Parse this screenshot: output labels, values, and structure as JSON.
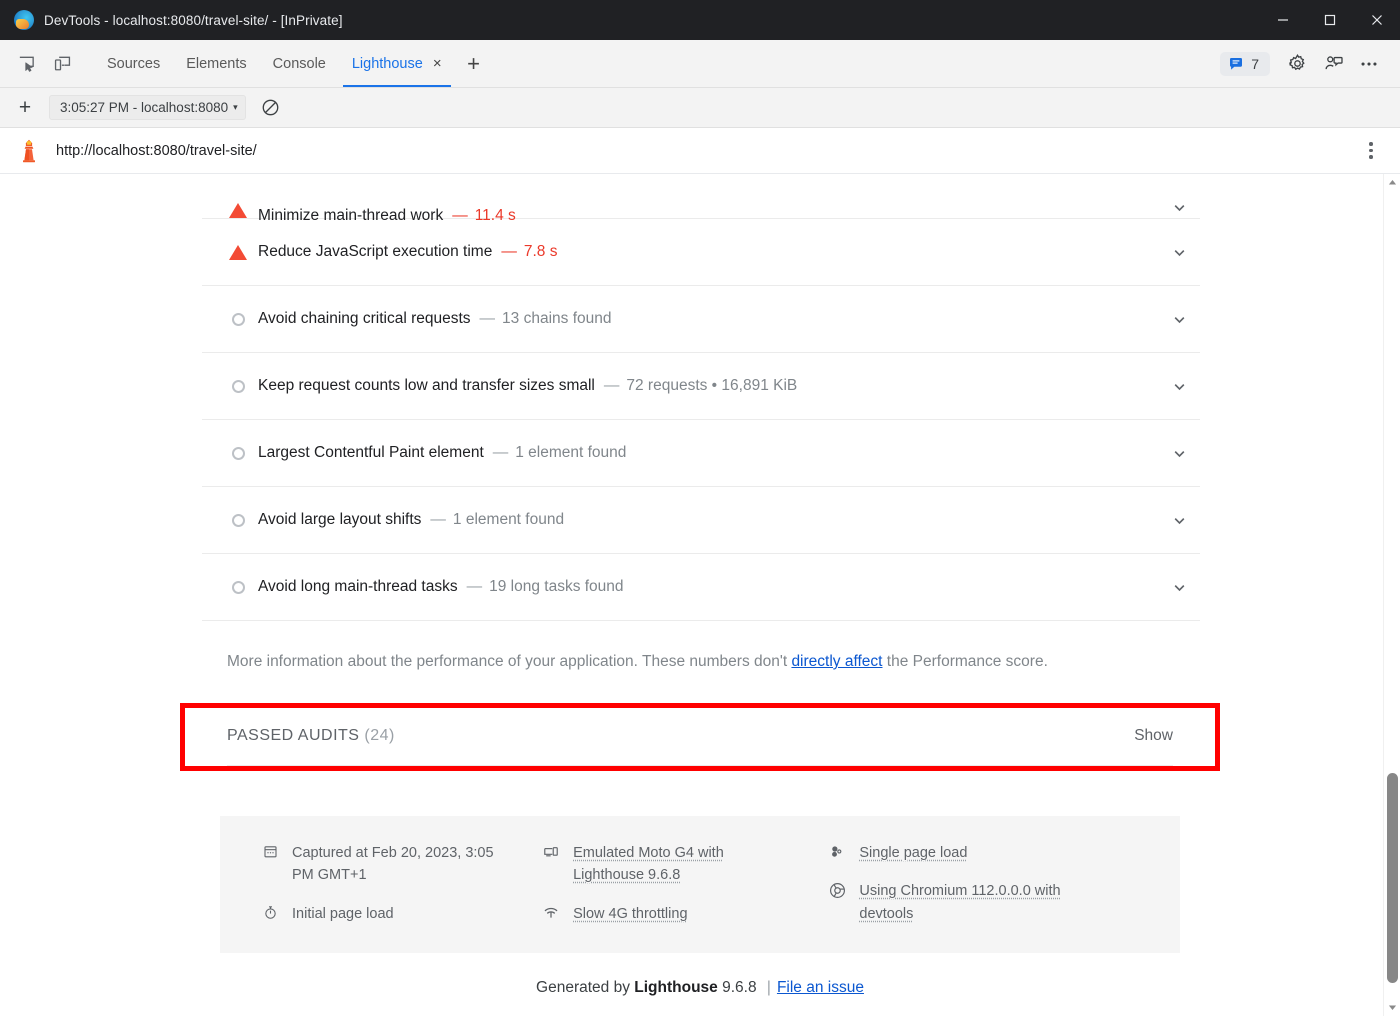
{
  "window": {
    "title": "DevTools - localhost:8080/travel-site/ - [InPrivate]",
    "minimize_label": "Minimize",
    "maximize_label": "Maximize",
    "close_label": "Close"
  },
  "devtools": {
    "inspect_icon": "inspect-element-icon",
    "device_icon": "device-toolbar-icon",
    "tabs": [
      {
        "label": "Sources",
        "active": false
      },
      {
        "label": "Elements",
        "active": false
      },
      {
        "label": "Console",
        "active": false
      },
      {
        "label": "Lighthouse",
        "active": true
      }
    ],
    "tab_close_glyph": "×",
    "more_tabs_glyph": "+",
    "messages_count": "7",
    "settings_icon": "gear-icon",
    "feedback_icon": "feedback-person-icon",
    "more_icon": "more-horizontal-icon"
  },
  "lighthouse_toolbar": {
    "new_report_glyph": "+",
    "report_select_value": "3:05:27 PM - localhost:8080",
    "caret_glyph": "▾",
    "clear_icon": "clear-all-icon"
  },
  "report": {
    "url": "http://localhost:8080/travel-site/",
    "lighthouse_icon": "lighthouse-logo-icon",
    "kebab_icon": "more-vertical-icon"
  },
  "audits": [
    {
      "status": "fail",
      "title": "Minimize main-thread work",
      "dash": "—",
      "value": "11.4 s",
      "chevron": "chevron-down-icon"
    },
    {
      "status": "fail",
      "title": "Reduce JavaScript execution time",
      "dash": "—",
      "value": "7.8 s",
      "chevron": "chevron-down-icon"
    },
    {
      "status": "info",
      "title": "Avoid chaining critical requests",
      "dash": "—",
      "value": "13 chains found",
      "chevron": "chevron-down-icon"
    },
    {
      "status": "info",
      "title": "Keep request counts low and transfer sizes small",
      "dash": "—",
      "value": "72 requests • 16,891 KiB",
      "chevron": "chevron-down-icon"
    },
    {
      "status": "info",
      "title": "Largest Contentful Paint element",
      "dash": "—",
      "value": "1 element found",
      "chevron": "chevron-down-icon"
    },
    {
      "status": "info",
      "title": "Avoid large layout shifts",
      "dash": "—",
      "value": "1 element found",
      "chevron": "chevron-down-icon"
    },
    {
      "status": "info",
      "title": "Avoid long main-thread tasks",
      "dash": "—",
      "value": "19 long tasks found",
      "chevron": "chevron-down-icon"
    }
  ],
  "more_info": {
    "before_link": "More information about the performance of your application. These numbers don't ",
    "link_text": "directly affect",
    "after_link": " the Performance score."
  },
  "passed_audits": {
    "label": "PASSED AUDITS",
    "count": "(24)",
    "toggle_label": "Show",
    "highlight_color": "#ff0000"
  },
  "metadata": {
    "columns": [
      [
        {
          "icon": "calendar-icon",
          "text": "Captured at Feb 20, 2023, 3:05 PM GMT+1",
          "dotted": false
        },
        {
          "icon": "stopwatch-icon",
          "text": "Initial page load",
          "dotted": false
        }
      ],
      [
        {
          "icon": "devices-icon",
          "text": "Emulated Moto G4 with Lighthouse 9.6.8",
          "dotted": true
        },
        {
          "icon": "network-throttle-icon",
          "text": "Slow 4G throttling",
          "dotted": true
        }
      ],
      [
        {
          "icon": "single-page-load-icon",
          "text": "Single page load",
          "dotted": true
        },
        {
          "icon": "chromium-icon",
          "text": "Using Chromium 112.0.0.0 with devtools",
          "dotted": true
        }
      ]
    ]
  },
  "generated_footer": {
    "prefix": "Generated by ",
    "brand": "Lighthouse",
    "version": " 9.6.8 ",
    "separator": "|",
    "link_text": "File an issue"
  },
  "colors": {
    "accent_blue": "#1a73e8",
    "link_blue": "#0b57d0",
    "fail_red": "#eb392a",
    "warn_triangle": "#f34b35",
    "info_gray": "#bdc1c6",
    "titlebar_bg": "#202124",
    "chrome_bg": "#f3f3f3",
    "meta_bg": "#f5f5f5"
  }
}
